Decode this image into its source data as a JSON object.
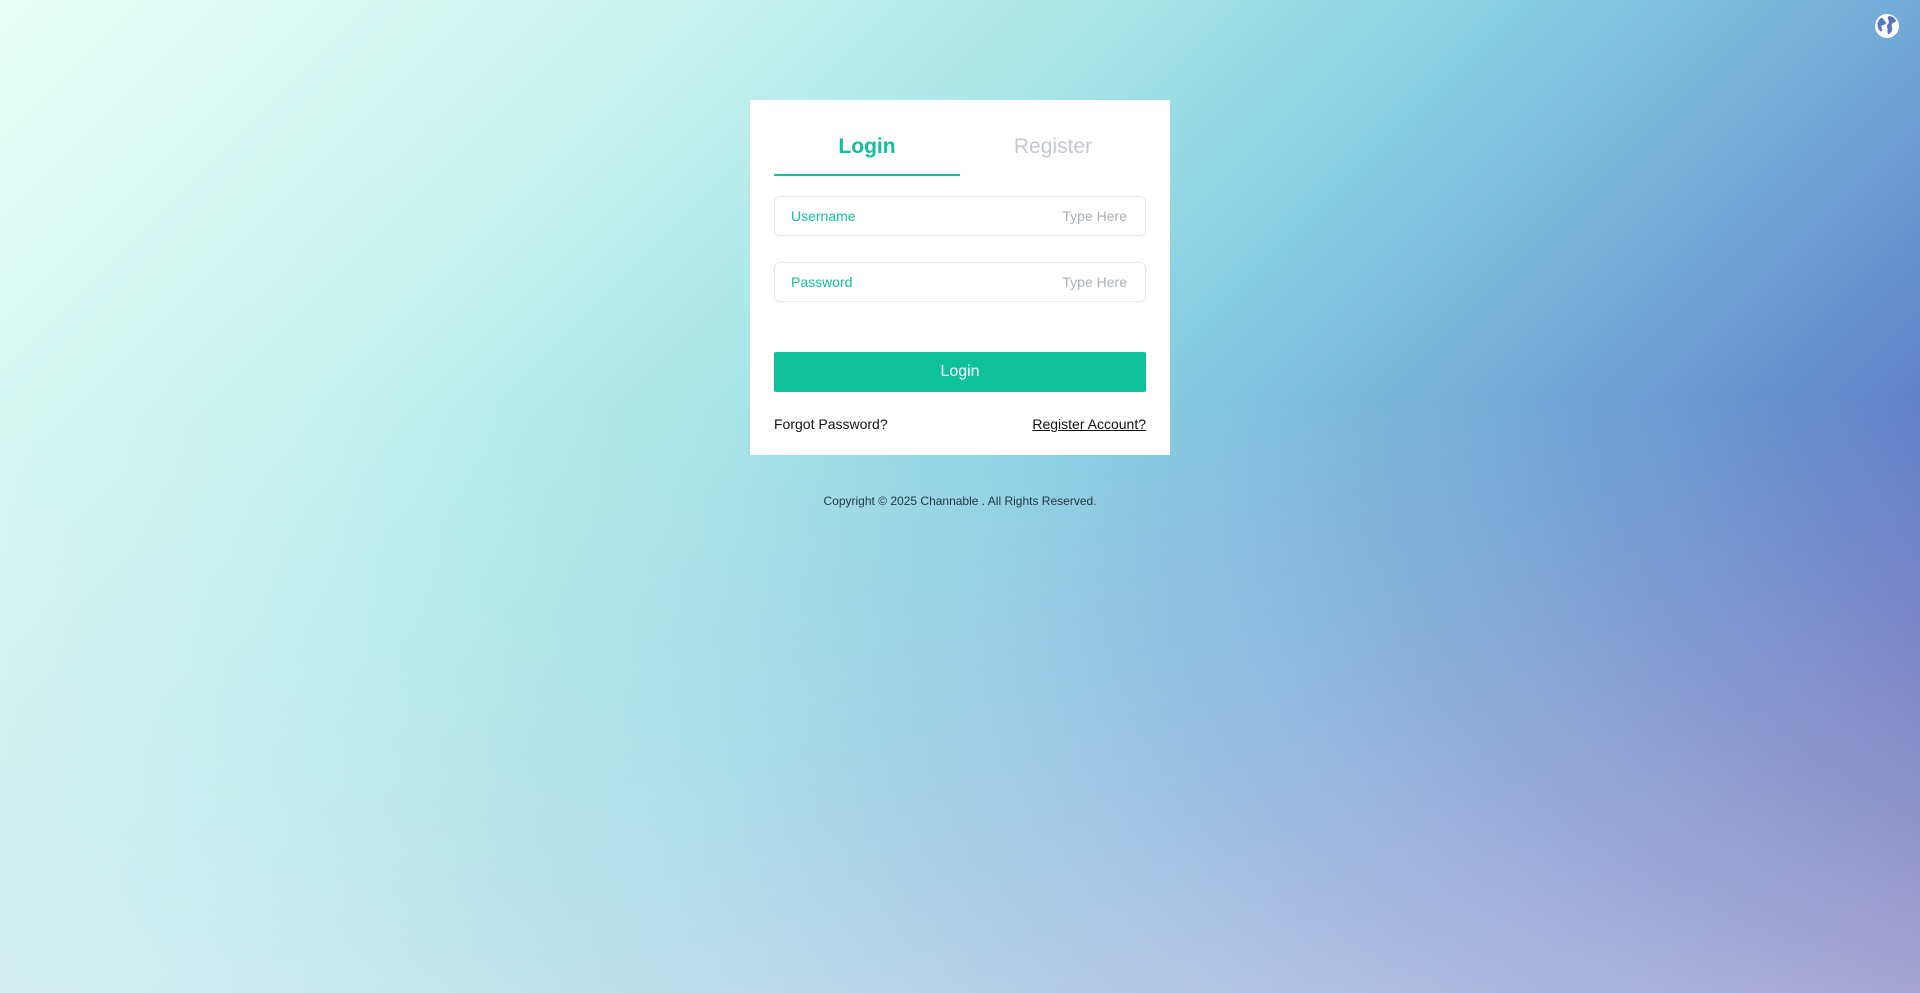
{
  "language_switch": {
    "icon": "globe-icon"
  },
  "auth_card": {
    "tabs": [
      {
        "label": "Login",
        "active": true
      },
      {
        "label": "Register",
        "active": false
      }
    ],
    "username": {
      "label": "Username",
      "placeholder": "Type Here",
      "value": ""
    },
    "password": {
      "label": "Password",
      "placeholder": "Type Here",
      "value": ""
    },
    "login_button_label": "Login",
    "forgot_password_label": "Forgot Password?",
    "register_account_label": "Register Account?"
  },
  "footer": {
    "copyright": "Copyright © 2025 Channable . All Rights Reserved."
  },
  "colors": {
    "accent": "#12bf9c",
    "button": "#0fc09c"
  }
}
